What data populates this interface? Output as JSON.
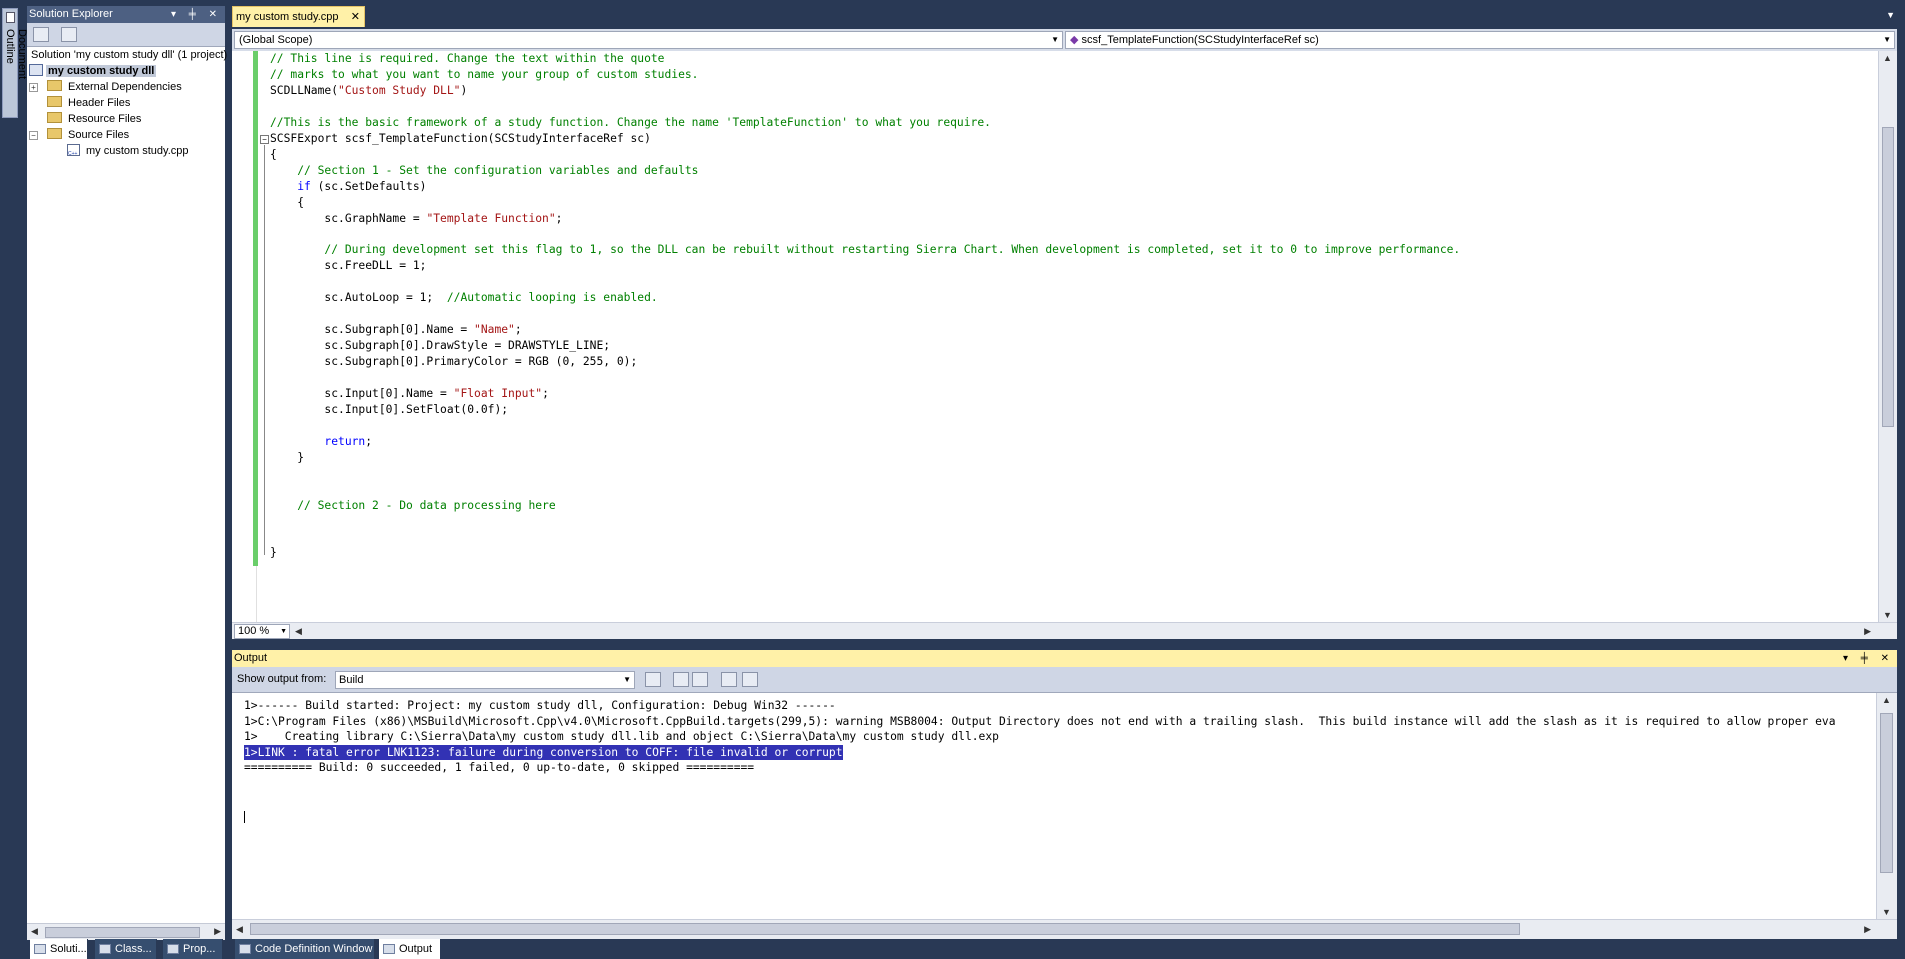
{
  "doc_outline": {
    "label": "Document Outline"
  },
  "solution_explorer": {
    "title": "Solution Explorer",
    "title_buttons": "▾ ╪ ✕",
    "tree": {
      "solution": "Solution 'my custom study dll' (1 project)",
      "project": "my custom study dll",
      "external_deps": "External Dependencies",
      "header_files": "Header Files",
      "resource_files": "Resource Files",
      "source_files": "Source Files",
      "file": "my custom study.cpp"
    }
  },
  "bottom_tabs": {
    "solution": "Soluti...",
    "class": "Class...",
    "prop": "Prop...",
    "code_def": "Code Definition Window",
    "output": "Output"
  },
  "editor": {
    "tab_label": "my custom study.cpp",
    "tab_close": "✕",
    "scope": "(Global Scope)",
    "function": "scsf_TemplateFunction(SCStudyInterfaceRef sc)",
    "zoom": "100 %",
    "lines": [
      {
        "text": "// This line is required. Change the text within the quote",
        "kind": "cm"
      },
      {
        "text": "// marks to what you want to name your group of custom studies.",
        "kind": "cm"
      },
      {
        "text": "SCDLLName(",
        "kind": "plain",
        "str": "\"Custom Study DLL\"",
        "tail": ")"
      },
      {
        "text": "",
        "kind": "plain"
      },
      {
        "text": "//This is the basic framework of a study function. Change the name 'TemplateFunction' to what you require.",
        "kind": "cm"
      },
      {
        "text": "SCSFExport scsf_TemplateFunction(SCStudyInterfaceRef sc)",
        "kind": "plain"
      },
      {
        "text": "{",
        "kind": "plain"
      },
      {
        "text": "    // Section 1 - Set the configuration variables and defaults",
        "kind": "cm"
      },
      {
        "text": "    ",
        "kind": "plain",
        "kw": "if",
        "tail": " (sc.SetDefaults)"
      },
      {
        "text": "    {",
        "kind": "plain"
      },
      {
        "text": "        sc.GraphName = ",
        "kind": "plain",
        "str": "\"Template Function\"",
        "tail": ";"
      },
      {
        "text": "",
        "kind": "plain"
      },
      {
        "text": "        // During development set this flag to 1, so the DLL can be rebuilt without restarting Sierra Chart. When development is completed, set it to 0 to improve performance.",
        "kind": "cm"
      },
      {
        "text": "        sc.FreeDLL = 1;",
        "kind": "plain"
      },
      {
        "text": "",
        "kind": "plain"
      },
      {
        "text": "        sc.AutoLoop = 1;  ",
        "kind": "plain",
        "cm": "//Automatic looping is enabled."
      },
      {
        "text": "",
        "kind": "plain"
      },
      {
        "text": "        sc.Subgraph[0].Name = ",
        "kind": "plain",
        "str": "\"Name\"",
        "tail": ";"
      },
      {
        "text": "        sc.Subgraph[0].DrawStyle = DRAWSTYLE_LINE;",
        "kind": "plain"
      },
      {
        "text": "        sc.Subgraph[0].PrimaryColor = RGB (0, 255, 0);",
        "kind": "plain"
      },
      {
        "text": "",
        "kind": "plain"
      },
      {
        "text": "        sc.Input[0].Name = ",
        "kind": "plain",
        "str": "\"Float Input\"",
        "tail": ";"
      },
      {
        "text": "        sc.Input[0].SetFloat(0.0f);",
        "kind": "plain"
      },
      {
        "text": "",
        "kind": "plain"
      },
      {
        "text": "        ",
        "kind": "plain",
        "kw": "return",
        "tail": ";"
      },
      {
        "text": "    }",
        "kind": "plain"
      },
      {
        "text": "",
        "kind": "plain"
      },
      {
        "text": "",
        "kind": "plain"
      },
      {
        "text": "    // Section 2 - Do data processing here",
        "kind": "cm"
      },
      {
        "text": "",
        "kind": "plain"
      },
      {
        "text": "",
        "kind": "plain"
      },
      {
        "text": "}",
        "kind": "plain"
      }
    ]
  },
  "output": {
    "title": "Output",
    "title_buttons": "▾ ╪ ✕",
    "show_from_label": "Show output from:",
    "show_from_value": "Build",
    "lines": [
      "1>------ Build started: Project: my custom study dll, Configuration: Debug Win32 ------",
      "1>C:\\Program Files (x86)\\MSBuild\\Microsoft.Cpp\\v4.0\\Microsoft.CppBuild.targets(299,5): warning MSB8004: Output Directory does not end with a trailing slash.  This build instance will add the slash as it is required to allow proper eva",
      "1>    Creating library C:\\Sierra\\Data\\my custom study dll.lib and object C:\\Sierra\\Data\\my custom study dll.exp",
      "1>LINK : fatal error LNK1123: failure during conversion to COFF: file invalid or corrupt",
      "========== Build: 0 succeeded, 1 failed, 0 up-to-date, 0 skipped =========="
    ],
    "highlighted_line": 3
  },
  "colors": {
    "chrome": "#293955",
    "active_title": "#fff1a8",
    "comment": "#008000",
    "keyword": "#0000ff",
    "string": "#a31515",
    "change_bar": "#6ace6a",
    "selection": "#3232b4"
  }
}
